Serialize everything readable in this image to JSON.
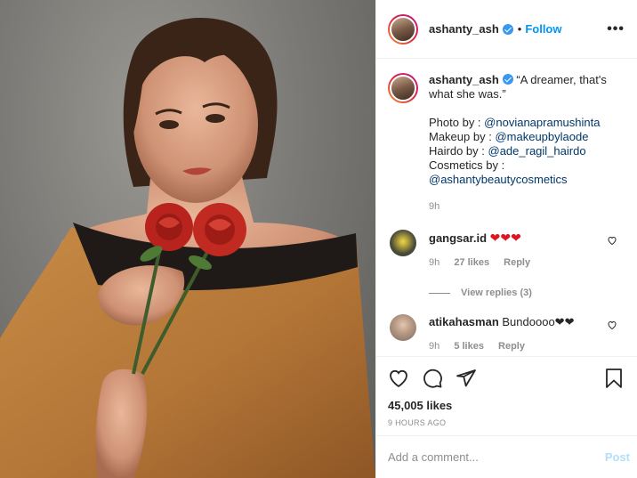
{
  "post": {
    "username": "ashanty_ash",
    "follow_label": "Follow",
    "dot": "•",
    "more_label": "•••",
    "caption": {
      "text": "“A dreamer, that's what she was.”",
      "photo_by_label": "Photo by :",
      "photo_by": "@novianapramushinta",
      "makeup_label": "Makeup by :",
      "makeup_by": "@makeupbylaode",
      "hairdo_label": "Hairdo by :",
      "hairdo_by": "@ade_ragil_hairdo",
      "cosmetics_label": "Cosmetics by :",
      "cosmetics_by": "@ashantybeautycosmetics",
      "age": "9h"
    },
    "comments": [
      {
        "username": "gangsar.id",
        "text": "❤❤❤",
        "age": "9h",
        "likes": "27 likes",
        "reply": "Reply"
      },
      {
        "username": "atikahasman",
        "text": "Bundoooo❤❤",
        "age": "9h",
        "likes": "5 likes",
        "reply": "Reply"
      }
    ],
    "view_replies": "View replies (3)",
    "likes": "45,005 likes",
    "time": "9 HOURS AGO",
    "add_comment_placeholder": "Add a comment...",
    "post_label": "Post"
  },
  "colors": {
    "accent": "#0095f6",
    "verified": "#3897f0",
    "heart": "#e0141e",
    "post_disabled": "#b2dffc"
  },
  "icons": [
    "verified-badge-icon",
    "more-options-icon",
    "heart-icon",
    "comment-icon",
    "share-icon",
    "bookmark-icon"
  ]
}
